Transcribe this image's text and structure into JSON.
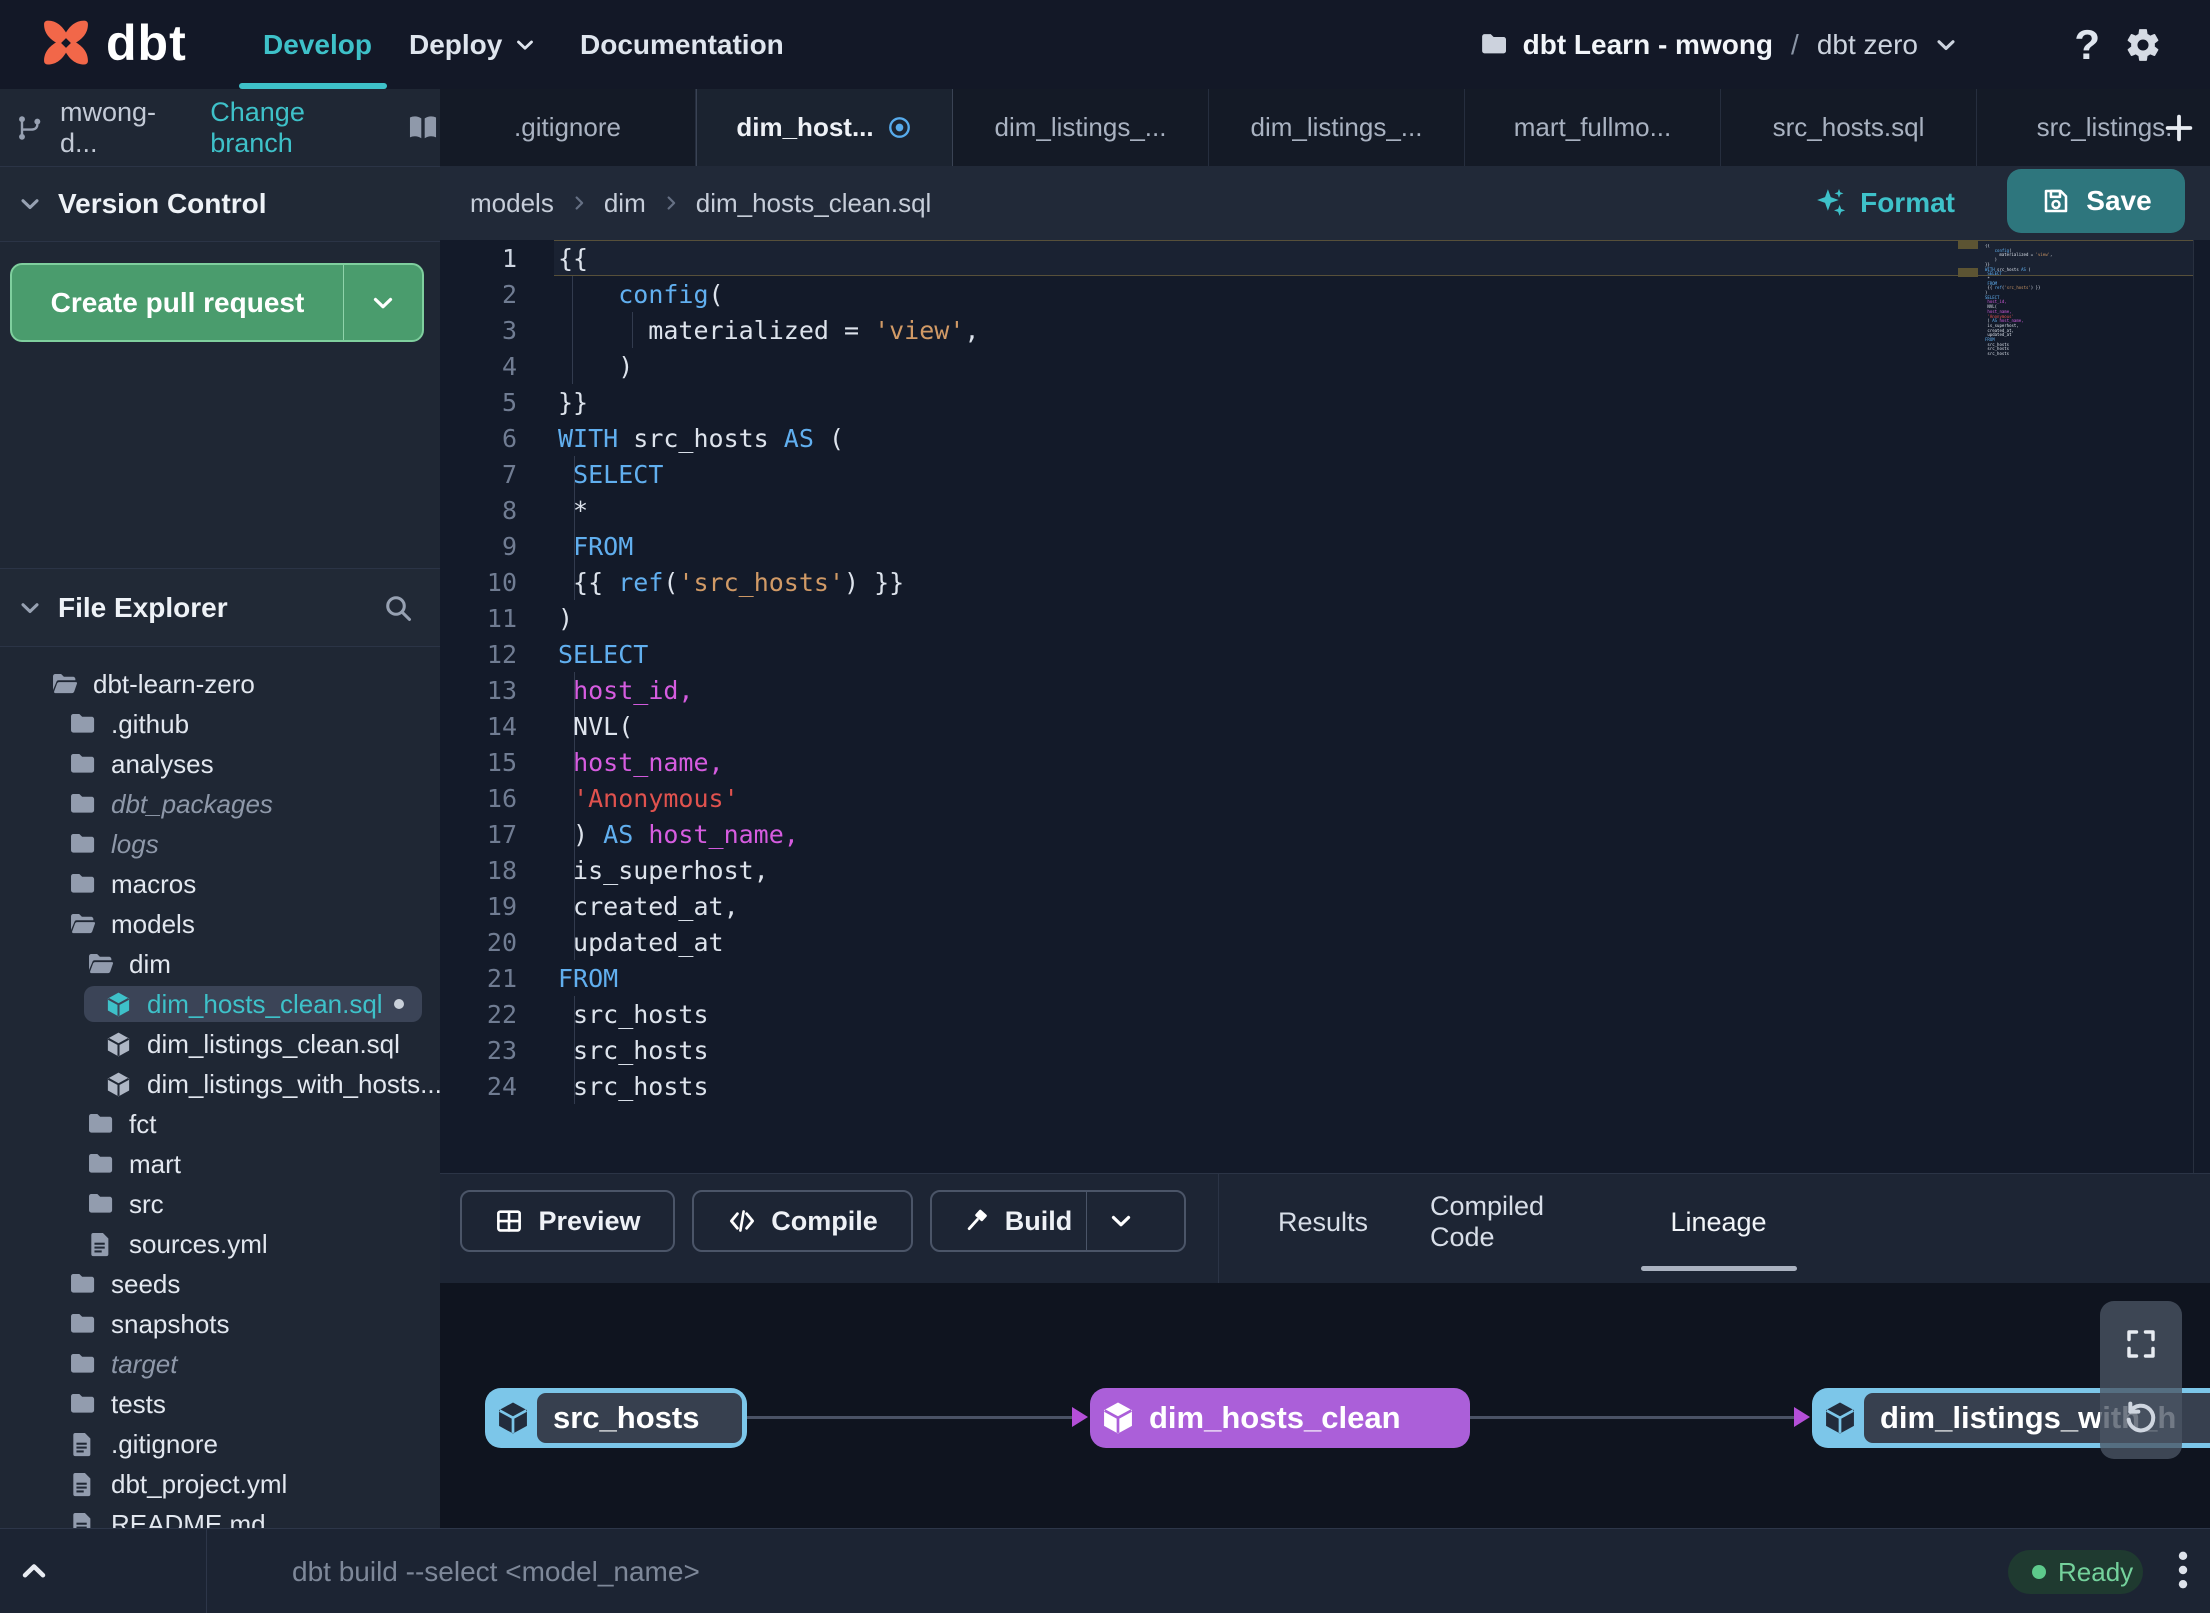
{
  "nav": {
    "brand": "dbt",
    "develop": "Develop",
    "deploy": "Deploy",
    "documentation": "Documentation",
    "project": "dbt Learn - mwong",
    "separator": "/",
    "environment": "dbt zero"
  },
  "branch_bar": {
    "branch": "mwong-d...",
    "change_branch": "Change branch"
  },
  "version_control": {
    "title": "Version Control",
    "create_pr": "Create pull request"
  },
  "file_explorer": {
    "title": "File Explorer",
    "tree": [
      {
        "label": "dbt-learn-zero",
        "icon": "folder-open-icon",
        "level": 0
      },
      {
        "label": ".github",
        "icon": "folder-icon",
        "level": 1
      },
      {
        "label": "analyses",
        "icon": "folder-icon",
        "level": 1
      },
      {
        "label": "dbt_packages",
        "icon": "folder-icon",
        "level": 1,
        "italic": true
      },
      {
        "label": "logs",
        "icon": "folder-icon",
        "level": 1,
        "italic": true
      },
      {
        "label": "macros",
        "icon": "folder-icon",
        "level": 1
      },
      {
        "label": "models",
        "icon": "folder-open-icon",
        "level": 1
      },
      {
        "label": "dim",
        "icon": "folder-open-icon",
        "level": 2
      },
      {
        "label": "dim_hosts_clean.sql",
        "icon": "model-icon",
        "level": 3,
        "selected": true,
        "modified": true
      },
      {
        "label": "dim_listings_clean.sql",
        "icon": "model-icon",
        "level": 3
      },
      {
        "label": "dim_listings_with_hosts...",
        "icon": "model-icon",
        "level": 3
      },
      {
        "label": "fct",
        "icon": "folder-icon",
        "level": 2
      },
      {
        "label": "mart",
        "icon": "folder-icon",
        "level": 2
      },
      {
        "label": "src",
        "icon": "folder-icon",
        "level": 2
      },
      {
        "label": "sources.yml",
        "icon": "file-icon",
        "level": 2
      },
      {
        "label": "seeds",
        "icon": "folder-icon",
        "level": 1
      },
      {
        "label": "snapshots",
        "icon": "folder-icon",
        "level": 1
      },
      {
        "label": "target",
        "icon": "folder-icon",
        "level": 1,
        "italic": true
      },
      {
        "label": "tests",
        "icon": "folder-icon",
        "level": 1
      },
      {
        "label": ".gitignore",
        "icon": "file-icon",
        "level": 1
      },
      {
        "label": "dbt_project.yml",
        "icon": "file-icon",
        "level": 1
      },
      {
        "label": "README.md",
        "icon": "file-icon",
        "level": 1
      }
    ]
  },
  "tabs": {
    "items": [
      {
        "label": ".gitignore"
      },
      {
        "label": "dim_host...",
        "active": true,
        "modified": true
      },
      {
        "label": "dim_listings_..."
      },
      {
        "label": "dim_listings_..."
      },
      {
        "label": "mart_fullmo..."
      },
      {
        "label": "src_hosts.sql"
      },
      {
        "label": "src_listings."
      }
    ],
    "add_label": "+"
  },
  "breadcrumb": {
    "items": [
      "models",
      "dim",
      "dim_hosts_clean.sql"
    ]
  },
  "editor": {
    "format_label": "Format",
    "save_label": "Save",
    "current_line": 1,
    "code": [
      {
        "n": 1,
        "tk": [
          [
            "{{",
            "w"
          ]
        ]
      },
      {
        "n": 2,
        "tk": [
          [
            "    ",
            "w"
          ],
          [
            "config",
            "b"
          ],
          [
            "(",
            "w"
          ]
        ],
        "g": [
          14
        ]
      },
      {
        "n": 3,
        "tk": [
          [
            "      materialized = ",
            "w"
          ],
          [
            "'view'",
            "o"
          ],
          [
            ",",
            "w"
          ]
        ],
        "g": [
          14,
          74
        ]
      },
      {
        "n": 4,
        "tk": [
          [
            "    )",
            "w"
          ]
        ],
        "g": [
          14
        ]
      },
      {
        "n": 5,
        "tk": [
          [
            "}}",
            "w"
          ]
        ]
      },
      {
        "n": 6,
        "tk": [
          [
            "WITH",
            "b"
          ],
          [
            " src_hosts ",
            "w"
          ],
          [
            "AS",
            "b"
          ],
          [
            " (",
            "w"
          ]
        ]
      },
      {
        "n": 7,
        "tk": [
          [
            " ",
            "w"
          ],
          [
            "SELECT",
            "b"
          ]
        ],
        "g": [
          16
        ]
      },
      {
        "n": 8,
        "tk": [
          [
            " *",
            "w"
          ]
        ],
        "g": [
          16
        ]
      },
      {
        "n": 9,
        "tk": [
          [
            " ",
            "w"
          ],
          [
            "FROM",
            "b"
          ]
        ],
        "g": [
          16
        ]
      },
      {
        "n": 10,
        "tk": [
          [
            " {{ ",
            "w"
          ],
          [
            "ref",
            "b"
          ],
          [
            "(",
            "w"
          ],
          [
            "'src_hosts'",
            "o"
          ],
          [
            ") }}",
            "w"
          ]
        ],
        "g": [
          16
        ]
      },
      {
        "n": 11,
        "tk": [
          [
            ")",
            "w"
          ]
        ]
      },
      {
        "n": 12,
        "tk": [
          [
            "SELECT",
            "b"
          ]
        ]
      },
      {
        "n": 13,
        "tk": [
          [
            " ",
            "w"
          ],
          [
            "host_id,",
            "m"
          ]
        ],
        "g": [
          16
        ]
      },
      {
        "n": 14,
        "tk": [
          [
            " NVL(",
            "w"
          ]
        ],
        "g": [
          16
        ]
      },
      {
        "n": 15,
        "tk": [
          [
            " ",
            "w"
          ],
          [
            "host_name,",
            "m"
          ]
        ],
        "g": [
          16
        ]
      },
      {
        "n": 16,
        "tk": [
          [
            " ",
            "w"
          ],
          [
            "'Anonymous'",
            "r"
          ]
        ],
        "g": [
          16
        ]
      },
      {
        "n": 17,
        "tk": [
          [
            " ) ",
            "w"
          ],
          [
            "AS",
            "b"
          ],
          [
            " ",
            "w"
          ],
          [
            "host_name,",
            "m"
          ]
        ],
        "g": [
          16
        ]
      },
      {
        "n": 18,
        "tk": [
          [
            " is_superhost,",
            "w"
          ]
        ],
        "g": [
          16
        ]
      },
      {
        "n": 19,
        "tk": [
          [
            " created_at,",
            "w"
          ]
        ],
        "g": [
          16
        ]
      },
      {
        "n": 20,
        "tk": [
          [
            " updated_at",
            "w"
          ]
        ],
        "g": [
          16
        ]
      },
      {
        "n": 21,
        "tk": [
          [
            "FROM",
            "b"
          ]
        ]
      },
      {
        "n": 22,
        "tk": [
          [
            " src_hosts",
            "w"
          ]
        ],
        "g": [
          16
        ]
      },
      {
        "n": 23,
        "tk": [
          [
            " src_hosts",
            "w"
          ]
        ],
        "g": [
          16
        ]
      },
      {
        "n": 24,
        "tk": [
          [
            " src_hosts",
            "w"
          ]
        ],
        "g": [
          16
        ]
      }
    ]
  },
  "panel": {
    "buttons": [
      {
        "label": "Preview",
        "icon": "grid-icon"
      },
      {
        "label": "Compile",
        "icon": "code-icon"
      },
      {
        "label": "Build",
        "icon": "hammer-icon",
        "split": true
      }
    ],
    "tabs": [
      {
        "label": "Results"
      },
      {
        "label": "Compiled Code"
      },
      {
        "label": "Lineage",
        "active": true
      }
    ]
  },
  "lineage": {
    "nodes": [
      {
        "label": "src_hosts",
        "color": "blue"
      },
      {
        "label": "dim_hosts_clean",
        "color": "purple"
      },
      {
        "label": "dim_listings_with_h",
        "color": "blue"
      }
    ],
    "edges": [
      {
        "from": 0,
        "to": 1
      },
      {
        "from": 1,
        "to": 2
      }
    ]
  },
  "command_bar": {
    "placeholder": "dbt build --select <model_name>",
    "status": "Ready"
  },
  "colors": {
    "accent-teal": "#3ec1c9",
    "save-teal": "#2e767d",
    "pr-green": "#4a9c6d",
    "node-blue": "#7cc6e9",
    "node-purple": "#ab5fd9",
    "logo-orange": "#f26749"
  }
}
